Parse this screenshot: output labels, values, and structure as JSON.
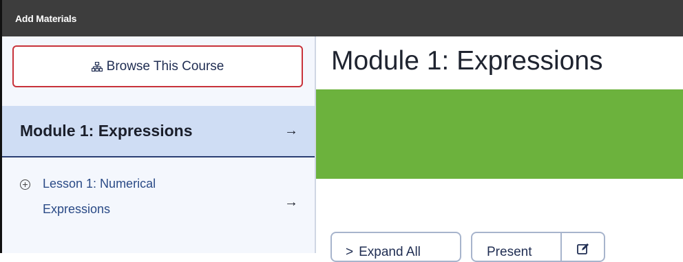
{
  "dialog": {
    "title": "Add Materials"
  },
  "sidebar": {
    "browse_label": "Browse This Course",
    "module": {
      "label": "Module 1: Expressions",
      "arrow": "→"
    },
    "lesson": {
      "label": "Lesson 1: Numerical Expressions",
      "arrow": "→"
    }
  },
  "main": {
    "title": "Module 1: Expressions",
    "banner_color": "#6cb23d",
    "expand_label": "Expand All",
    "expand_chevron": ">",
    "present_label": "Present"
  },
  "icons": {
    "browse": "sitemap-icon",
    "lesson": "circle-plus-icon",
    "edit": "edit-icon"
  }
}
